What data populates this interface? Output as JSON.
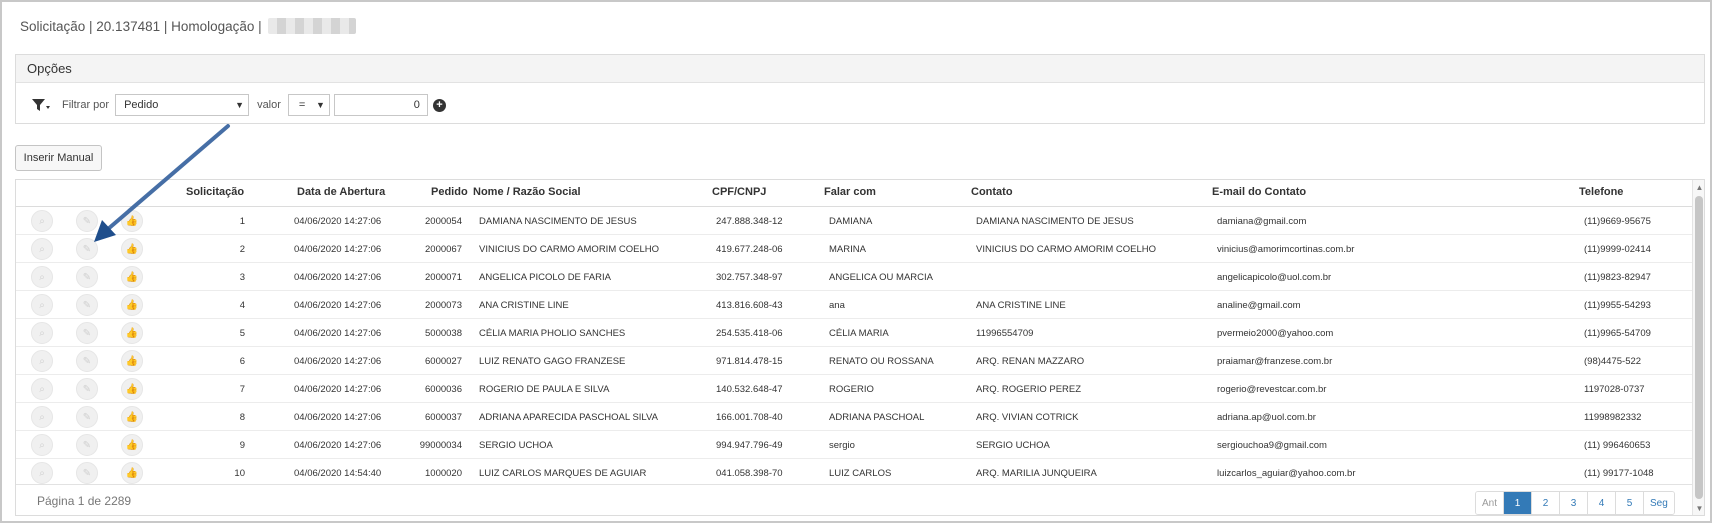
{
  "header": {
    "title": "Solicitação | 20.137481 | Homologação |"
  },
  "options": {
    "title": "Opções",
    "filter_label": "Filtrar por",
    "filter_field": "Pedido",
    "valor_label": "valor",
    "operator": "=",
    "value": "0",
    "filter_icon": "filter-icon",
    "add_icon": "plus-circle-icon"
  },
  "toolbar": {
    "insert_manual": "Inserir Manual"
  },
  "table": {
    "columns": [
      "Solicitação",
      "Data de Abertura",
      "Pedido",
      "Nome / Razão Social",
      "CPF/CNPJ",
      "Falar com",
      "Contato",
      "E-mail do Contato",
      "Telefone"
    ],
    "row_action_icons": [
      "search-icon",
      "pencil-icon",
      "thumbs-up-icon"
    ],
    "rows": [
      {
        "solicitacao": "1",
        "data": "04/06/2020 14:27:06",
        "pedido": "2000054",
        "nome": "DAMIANA NASCIMENTO DE JESUS",
        "cpf": "247.888.348-12",
        "falar": "DAMIANA",
        "contato": "DAMIANA NASCIMENTO DE JESUS",
        "email": "damiana@gmail.com",
        "telefone": "(11)9669-95675"
      },
      {
        "solicitacao": "2",
        "data": "04/06/2020 14:27:06",
        "pedido": "2000067",
        "nome": "VINICIUS DO CARMO AMORIM COELHO",
        "cpf": "419.677.248-06",
        "falar": "MARINA",
        "contato": "VINICIUS DO CARMO AMORIM COELHO",
        "email": "vinicius@amorimcortinas.com.br",
        "telefone": "(11)9999-02414"
      },
      {
        "solicitacao": "3",
        "data": "04/06/2020 14:27:06",
        "pedido": "2000071",
        "nome": "ANGELICA PICOLO DE FARIA",
        "cpf": "302.757.348-97",
        "falar": "ANGELICA OU MARCIA",
        "contato": "",
        "email": "angelicapicolo@uol.com.br",
        "telefone": "(11)9823-82947"
      },
      {
        "solicitacao": "4",
        "data": "04/06/2020 14:27:06",
        "pedido": "2000073",
        "nome": "ANA CRISTINE LINE",
        "cpf": "413.816.608-43",
        "falar": "ana",
        "contato": "ANA CRISTINE LINE",
        "email": "analine@gmail.com",
        "telefone": "(11)9955-54293"
      },
      {
        "solicitacao": "5",
        "data": "04/06/2020 14:27:06",
        "pedido": "5000038",
        "nome": "CÉLIA MARIA PHOLIO SANCHES",
        "cpf": "254.535.418-06",
        "falar": "CÉLIA MARIA",
        "contato": "11996554709",
        "email": "pvermeio2000@yahoo.com",
        "telefone": "(11)9965-54709"
      },
      {
        "solicitacao": "6",
        "data": "04/06/2020 14:27:06",
        "pedido": "6000027",
        "nome": "LUIZ RENATO GAGO FRANZESE",
        "cpf": "971.814.478-15",
        "falar": "RENATO OU ROSSANA",
        "contato": "ARQ. RENAN MAZZARO",
        "email": "praiamar@franzese.com.br",
        "telefone": "(98)4475-522"
      },
      {
        "solicitacao": "7",
        "data": "04/06/2020 14:27:06",
        "pedido": "6000036",
        "nome": "ROGERIO DE PAULA E SILVA",
        "cpf": "140.532.648-47",
        "falar": "ROGERIO",
        "contato": "ARQ. ROGERIO PEREZ",
        "email": "rogerio@revestcar.com.br",
        "telefone": "1197028-0737"
      },
      {
        "solicitacao": "8",
        "data": "04/06/2020 14:27:06",
        "pedido": "6000037",
        "nome": "ADRIANA APARECIDA PASCHOAL SILVA",
        "cpf": "166.001.708-40",
        "falar": "ADRIANA PASCHOAL",
        "contato": "ARQ. VIVIAN COTRICK",
        "email": "adriana.ap@uol.com.br",
        "telefone": "11998982332"
      },
      {
        "solicitacao": "9",
        "data": "04/06/2020 14:27:06",
        "pedido": "99000034",
        "nome": "SERGIO UCHOA",
        "cpf": "994.947.796-49",
        "falar": "sergio",
        "contato": "SERGIO UCHOA",
        "email": "sergiouchoa9@gmail.com",
        "telefone": "(11) 996460653"
      },
      {
        "solicitacao": "10",
        "data": "04/06/2020 14:54:40",
        "pedido": "1000020",
        "nome": "LUIZ CARLOS MARQUES DE AGUIAR",
        "cpf": "041.058.398-70",
        "falar": "LUIZ CARLOS",
        "contato": "ARQ. MARILIA JUNQUEIRA",
        "email": "luizcarlos_aguiar@yahoo.com.br",
        "telefone": "(11) 99177-1048"
      }
    ]
  },
  "pagination": {
    "info": "Página 1 de 2289",
    "prev": "Ant",
    "pages": [
      "1",
      "2",
      "3",
      "4",
      "5"
    ],
    "next": "Seg",
    "active_page": "1"
  },
  "colors": {
    "accent": "#337ab7",
    "annotation_arrow": "#1f4e8c"
  }
}
